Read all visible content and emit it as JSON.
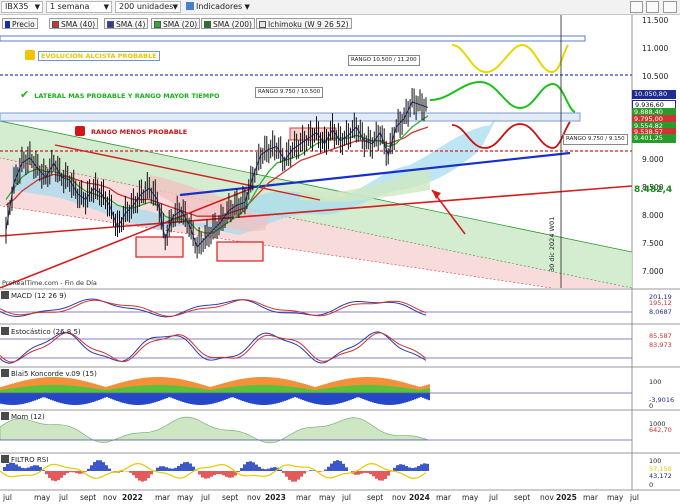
{
  "toolbar": {
    "symbol": "IBX35",
    "timeframe": "1 semana",
    "units": "200 unidades",
    "indicators_label": "Indicadores"
  },
  "legend": {
    "price_label": "Precio",
    "sma40": "SMA (40)",
    "sma4": "SMA (4)",
    "sma20": "SMA (20)",
    "sma200": "SMA (200)",
    "ichimoku": "Ichimoku (W 9 26 52)"
  },
  "annotations": {
    "bullish": "EVOLUCION ALCISTA PROBABLE",
    "lateral": "LATERAL MAS PROBABLE Y RANGO MAYOR TIEMPO",
    "bearish": "RANGO MENOS PROBABLE",
    "range_top": "RANGO 10.500 / 11.200",
    "range_mid": "RANGO 9.750 / 10.500",
    "range_low": "RANGO 9.750 / 9.150",
    "date_line": "30 dic 2024 W01",
    "source": "ProRealTime.com - Fin de Día"
  },
  "colors": {
    "bullish": "#e8c800",
    "lateral": "#19b219",
    "bearish": "#cc1111",
    "sma40": "#cc3333",
    "sma4": "#2c3aa8",
    "sma20": "#33aa33",
    "trend_blue": "#1630c8",
    "trend_red": "#d21e1e"
  },
  "chart_data": [
    {
      "type": "line",
      "name": "IBX35 weekly price",
      "yticks": [
        "11.500",
        "11.000",
        "10.500",
        "10.000",
        "9.500",
        "9.000",
        "8.500",
        "8.000",
        "7.500",
        "7.000"
      ],
      "ylim": [
        6.9,
        11.6
      ],
      "price_tags": [
        "10.050,80",
        "9.936,60",
        "9.888,40",
        "9.795,00",
        "9.554,82",
        "9.538,57",
        "9.401,25",
        "8.482,4"
      ],
      "xlabels": [
        "jul",
        "may",
        "jul",
        "sept",
        "nov",
        "2022",
        "mar",
        "may",
        "jul",
        "sept",
        "nov",
        "2023",
        "mar",
        "may",
        "jul",
        "sept",
        "nov",
        "2024",
        "mar",
        "may",
        "jul",
        "sept",
        "nov",
        "2025",
        "mar",
        "may",
        "jul"
      ],
      "series": [
        {
          "name": "Precio",
          "values": [
            7.75,
            8.6,
            8.95,
            9.05,
            8.85,
            8.7,
            8.95,
            8.7,
            8.65,
            8.4,
            8.3,
            8.5,
            8.4,
            8.2,
            7.8,
            8.05,
            8.2,
            8.4,
            8.5,
            8.3,
            7.6,
            8.0,
            8.1,
            7.85,
            7.45,
            7.6,
            7.75,
            7.9,
            8.1,
            8.2,
            8.25,
            8.7,
            9.1,
            9.2,
            9.25,
            9.0,
            9.2,
            9.3,
            9.4,
            9.5,
            9.3,
            9.55,
            9.35,
            9.45,
            9.6,
            9.35,
            9.3,
            9.5,
            9.1,
            9.6,
            9.75,
            10.05,
            10.0,
            9.95
          ]
        },
        {
          "name": "SMA (40)",
          "values": [
            8.2,
            8.3,
            8.45,
            8.55,
            8.65,
            8.7,
            8.75,
            8.72,
            8.7,
            8.65,
            8.6,
            8.58,
            8.55,
            8.5,
            8.4,
            8.35,
            8.3,
            8.3,
            8.3,
            8.25,
            8.2,
            8.15,
            8.1,
            8.05,
            8.0,
            8.0,
            8.0,
            8.0,
            8.05,
            8.1,
            8.15,
            8.3,
            8.45,
            8.6,
            8.7,
            8.8,
            8.9,
            9.0,
            9.05,
            9.1,
            9.15,
            9.2,
            9.25,
            9.3,
            9.35,
            9.35,
            9.35,
            9.35,
            9.3,
            9.35,
            9.4,
            9.5,
            9.55,
            9.6
          ]
        },
        {
          "name": "SMA (20)",
          "values": [
            8.3,
            8.5,
            8.7,
            8.8,
            8.85,
            8.8,
            8.8,
            8.75,
            8.7,
            8.55,
            8.45,
            8.4,
            8.35,
            8.3,
            8.2,
            8.15,
            8.15,
            8.2,
            8.25,
            8.2,
            8.0,
            7.95,
            7.95,
            7.9,
            7.75,
            7.7,
            7.7,
            7.8,
            7.9,
            8.0,
            8.1,
            8.35,
            8.6,
            8.8,
            8.95,
            9.0,
            9.05,
            9.1,
            9.2,
            9.3,
            9.35,
            9.4,
            9.4,
            9.4,
            9.45,
            9.4,
            9.35,
            9.35,
            9.25,
            9.3,
            9.45,
            9.6,
            9.7,
            9.8
          ]
        }
      ]
    },
    {
      "type": "line",
      "name": "MACD (12 26 9)",
      "tags": [
        "201,19",
        "195,12",
        "8,0687"
      ]
    },
    {
      "type": "line",
      "name": "Estocástico (26 8 5)",
      "tags": [
        "85,587",
        "83,973"
      ]
    },
    {
      "type": "area",
      "name": "Blai5 Koncorde v.09 (15)",
      "yticks": [
        "100",
        "0"
      ],
      "tags": [
        "-3,9016"
      ]
    },
    {
      "type": "area",
      "name": "Mom (12)",
      "yticks": [
        "1000",
        "0"
      ],
      "tags": [
        "642,70"
      ]
    },
    {
      "type": "line",
      "name": "FILTRO RSI",
      "yticks": [
        "100",
        "0"
      ],
      "tags": [
        "57,158",
        "43,172"
      ]
    }
  ]
}
